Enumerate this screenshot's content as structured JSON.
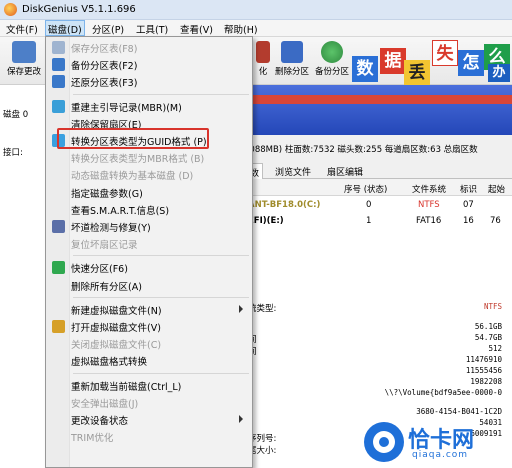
{
  "window": {
    "title": "DiskGenius V5.1.1.696"
  },
  "menubar": {
    "items": [
      "文件(F)",
      "磁盘(D)",
      "分区(P)",
      "工具(T)",
      "查看(V)",
      "帮助(H)"
    ]
  },
  "toolbar": {
    "save_label": "保存更改",
    "buttons": [
      "化",
      "删除分区",
      "备份分区"
    ]
  },
  "banner": {
    "tiles": [
      "数",
      "据",
      "丢",
      "失",
      "怎",
      "么",
      "办"
    ]
  },
  "left_pane": {
    "labels": [
      "磁盘 0",
      "接口:"
    ]
  },
  "disk_info": "5088MB) 柱面数:7532 磁头数:255 每道扇区数:63 总扇区数",
  "tabs": [
    "数",
    "浏览文件",
    "扇区编辑"
  ],
  "partition_table": {
    "headers": [
      "序号 (状态)",
      "文件系统",
      "标识",
      "起始"
    ],
    "rows": [
      {
        "name": "ANT-BF18.0(C:)",
        "seq": "0",
        "fs": "NTFS",
        "id": "07",
        "start": ""
      },
      {
        "name": "EFI)(E:)",
        "seq": "1",
        "fs": "FAT16",
        "id": "16",
        "start": "76"
      }
    ]
  },
  "details": {
    "labels": [
      "统类型:",
      "间",
      "间"
    ],
    "values": [
      "NTFS",
      "56.1GB",
      "54.7GB",
      "512",
      "11476910",
      "11555456",
      "1982208",
      "\\\\?\\Volume{bdf9a5ee-0000-0",
      "3680-4154-B041-1C2D",
      "54031",
      "6009191"
    ],
    "extra_labels": [
      "序列号:",
      "尾大小:"
    ]
  },
  "dropdown": {
    "items": [
      {
        "label": "保存分区表(F8)",
        "disabled": true,
        "icon": "save-icon",
        "color": "#9fb4d0"
      },
      {
        "label": "备份分区表(F2)",
        "disabled": false,
        "icon": "backup-table-icon",
        "color": "#3a78c9"
      },
      {
        "label": "还原分区表(F3)",
        "disabled": false,
        "icon": "restore-table-icon",
        "color": "#3a78c9"
      },
      {
        "sep": true
      },
      {
        "label": "重建主引导记录(MBR)(M)",
        "disabled": false,
        "icon": "mbr-icon",
        "color": "#3a9fd8"
      },
      {
        "label": "清除保留扇区(E)",
        "disabled": false,
        "icon": "",
        "color": ""
      },
      {
        "label": "转换分区表类型为GUID格式 (P)",
        "disabled": false,
        "icon": "convert-guid-icon",
        "color": "#3aa0e0"
      },
      {
        "label": "转换分区表类型为MBR格式 (B)",
        "disabled": true,
        "icon": "",
        "color": ""
      },
      {
        "label": "动态磁盘转换为基本磁盘 (D)",
        "disabled": true,
        "icon": "",
        "color": ""
      },
      {
        "label": "指定磁盘参数(G)",
        "disabled": false,
        "icon": "",
        "color": ""
      },
      {
        "label": "查看S.M.A.R.T.信息(S)",
        "disabled": false,
        "icon": "",
        "color": ""
      },
      {
        "label": "坏道检测与修复(Y)",
        "disabled": false,
        "icon": "repair-tools-icon",
        "color": "#5b6fa8"
      },
      {
        "label": "复位坏扇区记录",
        "disabled": true,
        "icon": "",
        "color": ""
      },
      {
        "sep": true
      },
      {
        "label": "快速分区(F6)",
        "disabled": false,
        "icon": "quick-partition-icon",
        "color": "#2fa84f"
      },
      {
        "label": "删除所有分区(A)",
        "disabled": false,
        "icon": "",
        "color": ""
      },
      {
        "sep": true
      },
      {
        "label": "新建虚拟磁盘文件(N)",
        "disabled": false,
        "icon": "",
        "color": "",
        "submenu": true
      },
      {
        "label": "打开虚拟磁盘文件(V)",
        "disabled": false,
        "icon": "open-virtual-disk-icon",
        "color": "#d6a028"
      },
      {
        "label": "关闭虚拟磁盘文件(C)",
        "disabled": true,
        "icon": "",
        "color": ""
      },
      {
        "label": "虚拟磁盘格式转换",
        "disabled": false,
        "icon": "",
        "color": ""
      },
      {
        "sep": true
      },
      {
        "label": "重新加载当前磁盘(Ctrl_L)",
        "disabled": false,
        "icon": "",
        "color": ""
      },
      {
        "label": "安全弹出磁盘(J)",
        "disabled": true,
        "icon": "",
        "color": ""
      },
      {
        "label": "更改设备状态",
        "disabled": false,
        "icon": "",
        "color": "",
        "submenu": true
      },
      {
        "label": "TRIM优化",
        "disabled": true,
        "icon": "",
        "color": ""
      }
    ]
  },
  "watermark": {
    "brand": "恰卡网",
    "url": "qiaqa.com"
  },
  "colors": {
    "highlight": "#d8342c",
    "brand_blue": "#1e6fd8",
    "menu_active": "#cde4f7"
  }
}
